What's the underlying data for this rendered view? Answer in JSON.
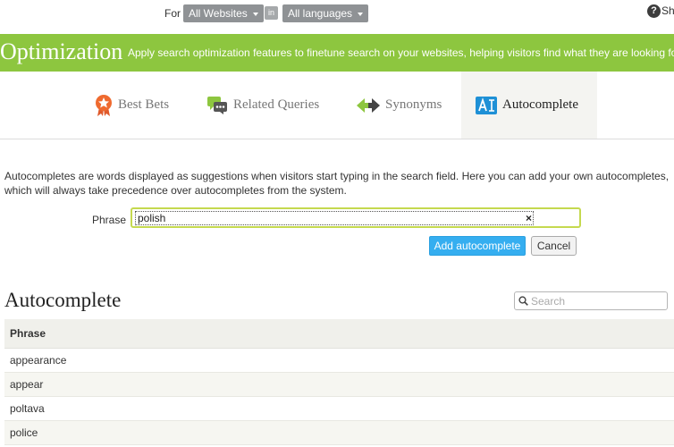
{
  "topbar": {
    "for_label": "For",
    "websites_dropdown": "All Websites",
    "in_badge": "in",
    "languages_dropdown": "All languages",
    "help_text": "Sh"
  },
  "banner": {
    "title": "Optimization",
    "description": "Apply search optimization features to finetune search on your websites, helping visitors find what they are looking for."
  },
  "tabs": [
    {
      "label": "Best Bets",
      "icon": "ribbon-star-icon",
      "active": false
    },
    {
      "label": "Related Queries",
      "icon": "chat-bubbles-icon",
      "active": false
    },
    {
      "label": "Synonyms",
      "icon": "arrows-exchange-icon",
      "active": false
    },
    {
      "label": "Autocomplete",
      "icon": "autocomplete-icon",
      "active": true
    }
  ],
  "description": "Autocompletes are words displayed as suggestions when visitors start typing in the search field. Here you can add your own autocompletes, which will always take precedence over autocompletes from the system.",
  "form": {
    "phrase_label": "Phrase",
    "phrase_value": "polish",
    "add_button": "Add autocomplete",
    "cancel_button": "Cancel"
  },
  "list": {
    "title": "Autocomplete",
    "search_placeholder": "Search",
    "column_header": "Phrase",
    "rows": [
      "appearance",
      "appear",
      "poltava",
      "police"
    ]
  },
  "colors": {
    "banner_green": "#8dc63f",
    "primary_button": "#35aef0",
    "input_focus_border": "#c5d94f"
  }
}
